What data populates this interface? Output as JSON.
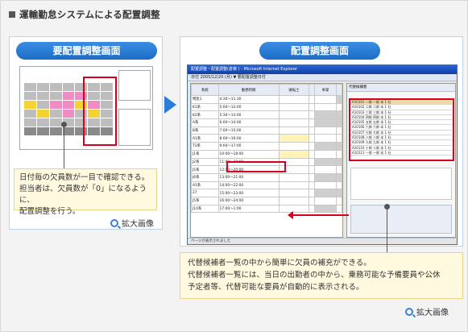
{
  "heading": "運輸勤怠システムによる配置調整",
  "left_panel": {
    "title": "要配置調整画面",
    "note_lines": [
      "日付毎の欠員数が一目で確認できる。",
      "担当者は、欠員数が「0」になるように、",
      "配置調整を行う。"
    ],
    "zoom_label": "拡大画像"
  },
  "right_panel": {
    "title": "配置調整画面",
    "window_title": "配置調整・配置調整(倉庫 ) - Microsoft Internet Explorer",
    "window_bar": "日付  2005/12/20  (月)  ▼   要配置調整日付",
    "side_title": "代替候補者",
    "status_text": "ページが表示されました",
    "note_lines": [
      "代替候補者一覧の中から簡単に欠員の補充ができる。",
      "代替候補者一覧には、当日の出勤者の中から、乗務可能な予備要員や公休",
      "予定者等、代替可能な要員が自動的に表示される。"
    ],
    "zoom_label": "拡大画像"
  },
  "table": {
    "headers": [
      "系統",
      "勤務時間",
      "運転士",
      "",
      "車掌",
      ""
    ],
    "rows": [
      [
        "特急1",
        "4:30〜11:30"
      ],
      [
        "K1系",
        "5:00〜12:00"
      ],
      [
        "K2系",
        "5:30〜13:00"
      ],
      [
        "A系",
        "6:00〜14:00"
      ],
      [
        "B系",
        "7:00〜15:00"
      ],
      [
        "A1系",
        "8:00〜16:00"
      ],
      [
        "T3系",
        "9:00〜17:00"
      ],
      [
        "J1系",
        "10:00〜18:00"
      ],
      [
        "J2系",
        "11:00〜19:00"
      ],
      [
        "J5系",
        "12:00〜20:00"
      ],
      [
        "J6系",
        "13:00〜21:00"
      ],
      [
        "A1系",
        "14:00〜22:00"
      ],
      [
        "27",
        "15:00〜23:00"
      ],
      [
        "J5系",
        "16:00〜24:00"
      ],
      [
        "J10系",
        "17:00〜1:00"
      ]
    ]
  },
  "side_rows": [
    "A10101 一郎 一郎  本 1 社",
    "A10102 二郎 二郎  本 1 社",
    "A10103 三郎 三郎  本 1 社",
    "A10104 四郎 四郎  本 1 社",
    "A10105 五郎 五郎  本 1 社",
    "A10106 六郎 六郎  本 1 社",
    "A10107 七郎 七郎  本 1 社",
    "A10108 八郎 八郎  本 1 社",
    "A10109 九郎 九郎  本 1 社",
    "A10110 十郎 十郎  本 1 社",
    "A10111 一郎 一郎  本 1 社"
  ]
}
